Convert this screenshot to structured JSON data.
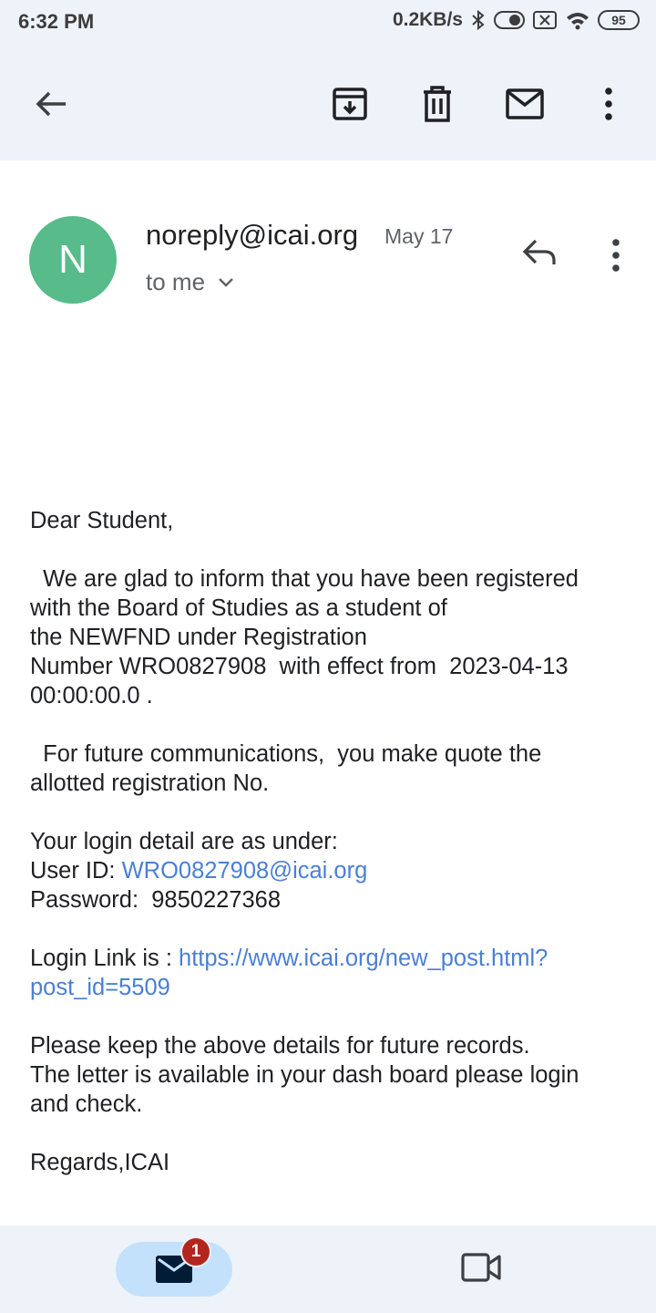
{
  "status_bar": {
    "time": "6:32 PM",
    "speed": "0.2KB/s",
    "battery": "95",
    "icons": [
      "bluetooth-icon",
      "toggle-icon",
      "sim-off-icon",
      "wifi-icon",
      "battery-icon"
    ]
  },
  "toolbar": {
    "icons": [
      "back-arrow-icon",
      "archive-icon",
      "delete-icon",
      "mark-unread-icon",
      "more-vert-icon"
    ]
  },
  "email": {
    "avatar_letter": "N",
    "sender": "noreply@icai.org",
    "date": "May 17",
    "recipient": "to me",
    "body": {
      "greeting": "Dear Student,",
      "para1_l1": "We are glad to inform that you have been registered",
      "para1_l2": "with the Board of Studies as a student of",
      "para1_l3": "the NEWFND under Registration",
      "para1_l4": "Number WRO0827908  with effect from  2023-04-13",
      "para1_l5": "00:00:00.0 .",
      "para2_l1": "For future communications,  you make quote the",
      "para2_l2": "allotted registration No.",
      "login_intro": "Your login detail are as under:",
      "user_id_label": "User ID: ",
      "user_id_value": "WRO0827908@icai.org",
      "password_label": "Password:  ",
      "password_value": "9850227368",
      "link_label": "Login Link is : ",
      "link_l1": "https://www.icai.org/new_post.html?",
      "link_l2": "post_id=5509",
      "keep_l1": "Please keep the above details for future records.",
      "keep_l2": "The letter is available in your dash board please login",
      "keep_l3": "and check.",
      "regards": "Regards,ICAI"
    }
  },
  "bottom_nav": {
    "mail_badge": "1",
    "accent": "#c4e1fb",
    "badge_color": "#b3261e"
  }
}
